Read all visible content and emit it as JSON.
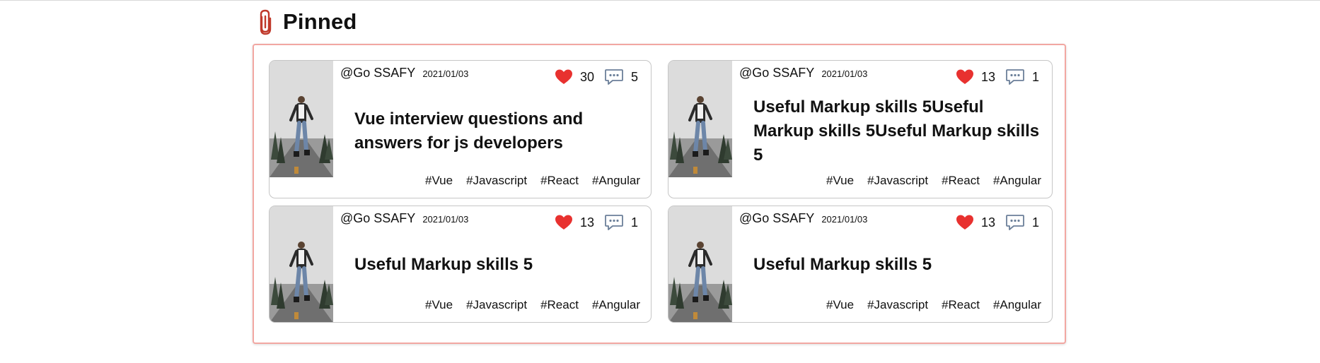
{
  "section": {
    "title": "Pinned",
    "icon": "paperclip-icon",
    "icon_color": "#c0392b",
    "border_color": "#f2a7a2"
  },
  "cards": [
    {
      "author": "@Go SSAFY",
      "date": "2021/01/03",
      "likes": "30",
      "comments": "5",
      "title_lines": [
        "Vue interview questions and",
        "answers for js developers"
      ],
      "tags": [
        "#Vue",
        "#Javascript",
        "#React",
        "#Angular"
      ]
    },
    {
      "author": "@Go SSAFY",
      "date": "2021/01/03",
      "likes": "13",
      "comments": "1",
      "title_lines": [
        "Useful Markup skills 5Useful",
        "Markup skills 5Useful Markup skills",
        "5"
      ],
      "tags": [
        "#Vue",
        "#Javascript",
        "#React",
        "#Angular"
      ]
    },
    {
      "author": "@Go SSAFY",
      "date": "2021/01/03",
      "likes": "13",
      "comments": "1",
      "title_lines": [
        "Useful Markup skills 5"
      ],
      "tags": [
        "#Vue",
        "#Javascript",
        "#React",
        "#Angular"
      ]
    },
    {
      "author": "@Go SSAFY",
      "date": "2021/01/03",
      "likes": "13",
      "comments": "1",
      "title_lines": [
        "Useful Markup skills 5"
      ],
      "tags": [
        "#Vue",
        "#Javascript",
        "#React",
        "#Angular"
      ]
    }
  ],
  "icons": {
    "like": "heart-icon",
    "comment": "comment-icon",
    "heart_color": "#e8312f",
    "comment_color": "#6b7f99"
  }
}
